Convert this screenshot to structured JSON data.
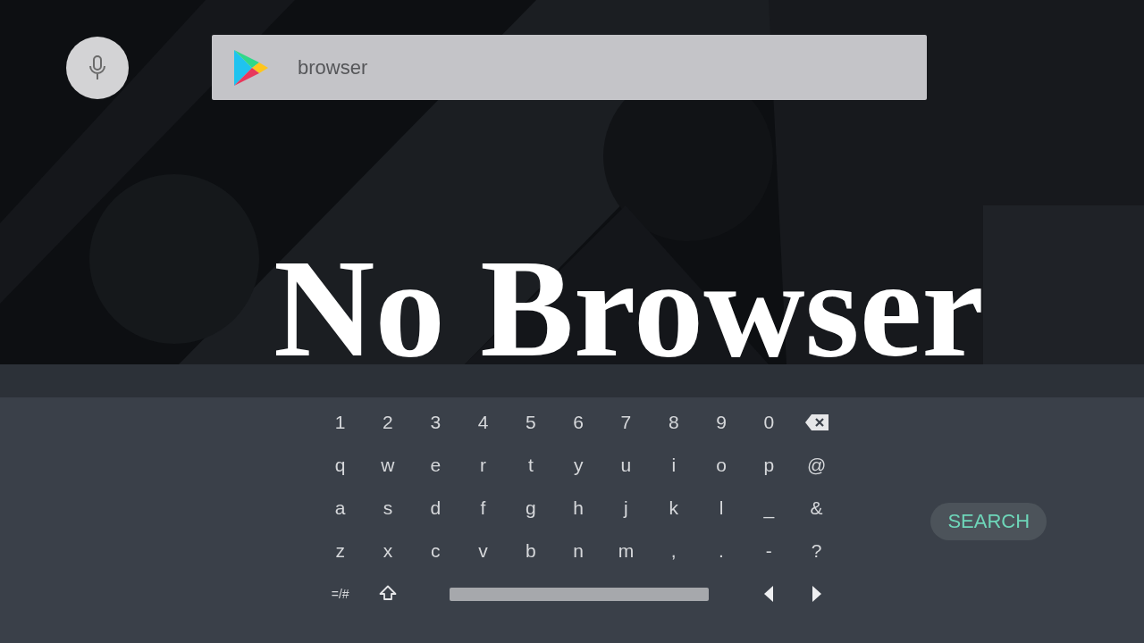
{
  "search_bar": {
    "value": "browser"
  },
  "headline": "No Browser",
  "keyboard": {
    "rows": [
      [
        {
          "kind": "char",
          "label": "1"
        },
        {
          "kind": "char",
          "label": "2"
        },
        {
          "kind": "char",
          "label": "3"
        },
        {
          "kind": "char",
          "label": "4"
        },
        {
          "kind": "char",
          "label": "5"
        },
        {
          "kind": "char",
          "label": "6"
        },
        {
          "kind": "char",
          "label": "7"
        },
        {
          "kind": "char",
          "label": "8"
        },
        {
          "kind": "char",
          "label": "9"
        },
        {
          "kind": "char",
          "label": "0"
        },
        {
          "kind": "backspace"
        }
      ],
      [
        {
          "kind": "char",
          "label": "q"
        },
        {
          "kind": "char",
          "label": "w"
        },
        {
          "kind": "char",
          "label": "e"
        },
        {
          "kind": "char",
          "label": "r"
        },
        {
          "kind": "char",
          "label": "t"
        },
        {
          "kind": "char",
          "label": "y"
        },
        {
          "kind": "char",
          "label": "u"
        },
        {
          "kind": "char",
          "label": "i"
        },
        {
          "kind": "char",
          "label": "o"
        },
        {
          "kind": "char",
          "label": "p"
        },
        {
          "kind": "char",
          "label": "@"
        }
      ],
      [
        {
          "kind": "char",
          "label": "a"
        },
        {
          "kind": "char",
          "label": "s"
        },
        {
          "kind": "char",
          "label": "d"
        },
        {
          "kind": "char",
          "label": "f"
        },
        {
          "kind": "char",
          "label": "g"
        },
        {
          "kind": "char",
          "label": "h"
        },
        {
          "kind": "char",
          "label": "j"
        },
        {
          "kind": "char",
          "label": "k"
        },
        {
          "kind": "char",
          "label": "l"
        },
        {
          "kind": "char",
          "label": "_"
        },
        {
          "kind": "char",
          "label": "&"
        }
      ],
      [
        {
          "kind": "char",
          "label": "z"
        },
        {
          "kind": "char",
          "label": "x"
        },
        {
          "kind": "char",
          "label": "c"
        },
        {
          "kind": "char",
          "label": "v"
        },
        {
          "kind": "char",
          "label": "b"
        },
        {
          "kind": "char",
          "label": "n"
        },
        {
          "kind": "char",
          "label": "m"
        },
        {
          "kind": "char",
          "label": ","
        },
        {
          "kind": "char",
          "label": "."
        },
        {
          "kind": "char",
          "label": "-"
        },
        {
          "kind": "char",
          "label": "?"
        }
      ],
      [
        {
          "kind": "symbols",
          "label": "=/#"
        },
        {
          "kind": "shift"
        },
        {
          "kind": "space"
        },
        {
          "kind": "left"
        },
        {
          "kind": "right"
        }
      ]
    ],
    "action": {
      "label": "SEARCH"
    }
  }
}
